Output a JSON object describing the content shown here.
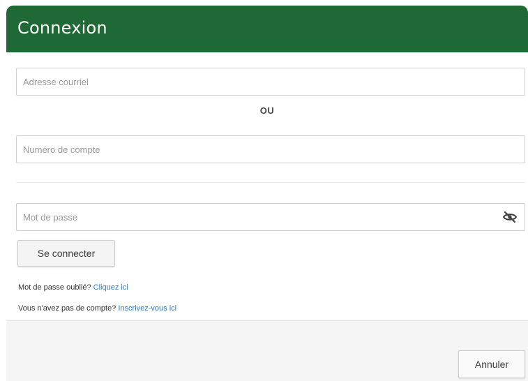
{
  "dialog": {
    "title": "Connexion"
  },
  "form": {
    "email": {
      "placeholder": "Adresse courriel",
      "value": ""
    },
    "or_label": "OU",
    "account": {
      "placeholder": "Numéro de compte",
      "value": ""
    },
    "password": {
      "placeholder": "Mot de passe",
      "value": "",
      "toggle_icon": "eye-slash-icon"
    },
    "login_button_label": "Se connecter"
  },
  "help": {
    "forgot_prefix": "Mot de passe oublié?",
    "forgot_link": "Cliquez ici",
    "signup_prefix": "Vous n'avez pas de compte?",
    "signup_link": "Inscrivez-vous ici"
  },
  "footer": {
    "cancel_label": "Annuler"
  },
  "colors": {
    "header_bg": "#1f6a34",
    "link": "#2a78c2"
  }
}
